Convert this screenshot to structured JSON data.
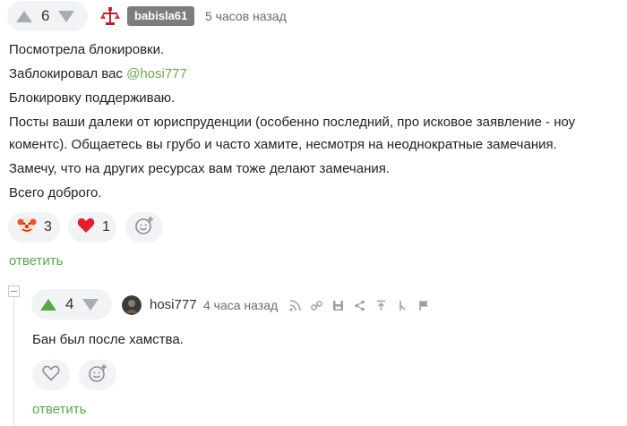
{
  "comment": {
    "rating": "6",
    "username": "babisla61",
    "time": "5 часов назад",
    "lines": [
      "Посмотрела блокировки.",
      "Заблокировал вас",
      "Блокировку поддерживаю.",
      "Посты ваши далеки от юриспруденции (особенно последний, про исковое заявление - ноу",
      "коментс). Общаетесь вы грубо и часто хамите, несмотря на неоднократные замечания.",
      "Замечу, что на других ресурсах вам тоже делают замечания.",
      "Всего доброго."
    ],
    "mention": "@hosi777",
    "reactions": [
      {
        "icon": "clown-emoji-icon",
        "count": "3"
      },
      {
        "icon": "heart-icon",
        "count": "1"
      }
    ],
    "reply_label": "ответить"
  },
  "reply": {
    "rating": "4",
    "username": "hosi777",
    "time": "4 часа назад",
    "text": "Бан был после хамства.",
    "toolbar_icons": [
      "thread-icon",
      "link-icon",
      "save-icon",
      "share-icon",
      "up-icon",
      "branch-icon",
      "flag-icon"
    ],
    "reply_label": "ответить"
  },
  "colors": {
    "accent_green": "#5aa64a",
    "mention_green": "#6fa84f",
    "pill_bg": "#f2f3f5",
    "badge_bg": "#7d7d7d",
    "heart_red": "#e0202d"
  }
}
